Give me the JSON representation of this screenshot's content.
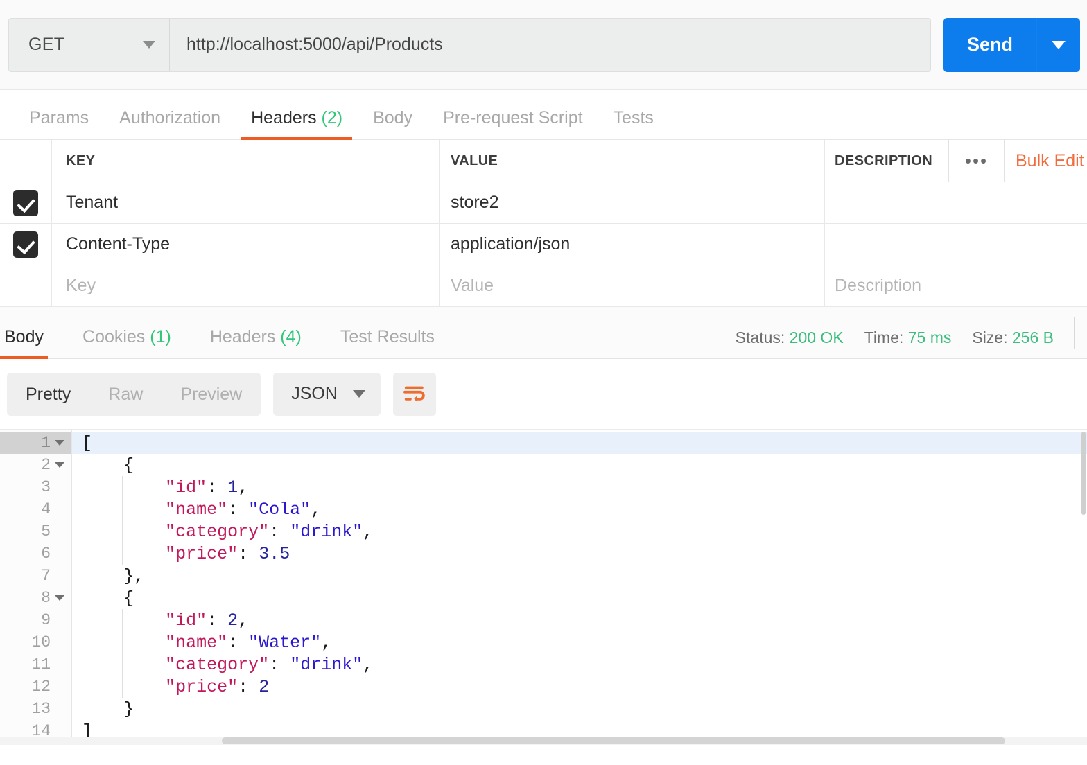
{
  "request": {
    "method": "GET",
    "url": "http://localhost:5000/api/Products",
    "send_label": "Send",
    "send_caret_icon": "chevron-down-icon",
    "method_caret_icon": "chevron-down-icon",
    "tabs": [
      {
        "label": "Params",
        "count": "",
        "active": false
      },
      {
        "label": "Authorization",
        "count": "",
        "active": false
      },
      {
        "label": "Headers",
        "count": "(2)",
        "active": true
      },
      {
        "label": "Body",
        "count": "",
        "active": false
      },
      {
        "label": "Pre-request Script",
        "count": "",
        "active": false
      },
      {
        "label": "Tests",
        "count": "",
        "active": false
      }
    ]
  },
  "headers_table": {
    "columns": {
      "key": "KEY",
      "value": "VALUE",
      "description": "DESCRIPTION"
    },
    "more_icon": "ellipsis-icon",
    "bulk_edit_label": "Bulk Edit",
    "rows": [
      {
        "checked": true,
        "key": "Tenant",
        "value": "store2",
        "description": ""
      },
      {
        "checked": true,
        "key": "Content-Type",
        "value": "application/json",
        "description": ""
      }
    ],
    "placeholder_row": {
      "key": "Key",
      "value": "Value",
      "description": "Description"
    }
  },
  "response": {
    "tabs": [
      {
        "label": "Body",
        "count": "",
        "active": true
      },
      {
        "label": "Cookies",
        "count": "(1)",
        "active": false
      },
      {
        "label": "Headers",
        "count": "(4)",
        "active": false
      },
      {
        "label": "Test Results",
        "count": "",
        "active": false
      }
    ],
    "stats": {
      "status_label": "Status:",
      "status_value": "200 OK",
      "time_label": "Time:",
      "time_value": "75 ms",
      "size_label": "Size:",
      "size_value": "256 B"
    },
    "view_modes": [
      {
        "label": "Pretty",
        "active": true
      },
      {
        "label": "Raw",
        "active": false
      },
      {
        "label": "Preview",
        "active": false
      }
    ],
    "format": "JSON",
    "format_caret_icon": "chevron-down-icon",
    "wrap_icon": "word-wrap-icon"
  },
  "code": {
    "lines": [
      {
        "num": "1",
        "fold": true,
        "current": true,
        "html": "["
      },
      {
        "num": "2",
        "fold": true,
        "current": false,
        "html": "    {"
      },
      {
        "num": "3",
        "fold": false,
        "current": false,
        "html": "        \"id\": 1,"
      },
      {
        "num": "4",
        "fold": false,
        "current": false,
        "html": "        \"name\": \"Cola\","
      },
      {
        "num": "5",
        "fold": false,
        "current": false,
        "html": "        \"category\": \"drink\","
      },
      {
        "num": "6",
        "fold": false,
        "current": false,
        "html": "        \"price\": 3.5"
      },
      {
        "num": "7",
        "fold": false,
        "current": false,
        "html": "    },"
      },
      {
        "num": "8",
        "fold": true,
        "current": false,
        "html": "    {"
      },
      {
        "num": "9",
        "fold": false,
        "current": false,
        "html": "        \"id\": 2,"
      },
      {
        "num": "10",
        "fold": false,
        "current": false,
        "html": "        \"name\": \"Water\","
      },
      {
        "num": "11",
        "fold": false,
        "current": false,
        "html": "        \"category\": \"drink\","
      },
      {
        "num": "12",
        "fold": false,
        "current": false,
        "html": "        \"price\": 2"
      },
      {
        "num": "13",
        "fold": false,
        "current": false,
        "html": "    }"
      },
      {
        "num": "14",
        "fold": false,
        "current": false,
        "html": "]"
      }
    ],
    "body_json": [
      {
        "id": 1,
        "name": "Cola",
        "category": "drink",
        "price": 3.5
      },
      {
        "id": 2,
        "name": "Water",
        "category": "drink",
        "price": 2
      }
    ]
  },
  "colors": {
    "accent_orange": "#ef5b25",
    "send_blue": "#0d7ced",
    "success_green": "#34c77b",
    "bulk_edit_orange": "#f26b3a",
    "json_key": "#c2185b",
    "json_string": "#2b17cf",
    "json_number": "#24249c"
  }
}
